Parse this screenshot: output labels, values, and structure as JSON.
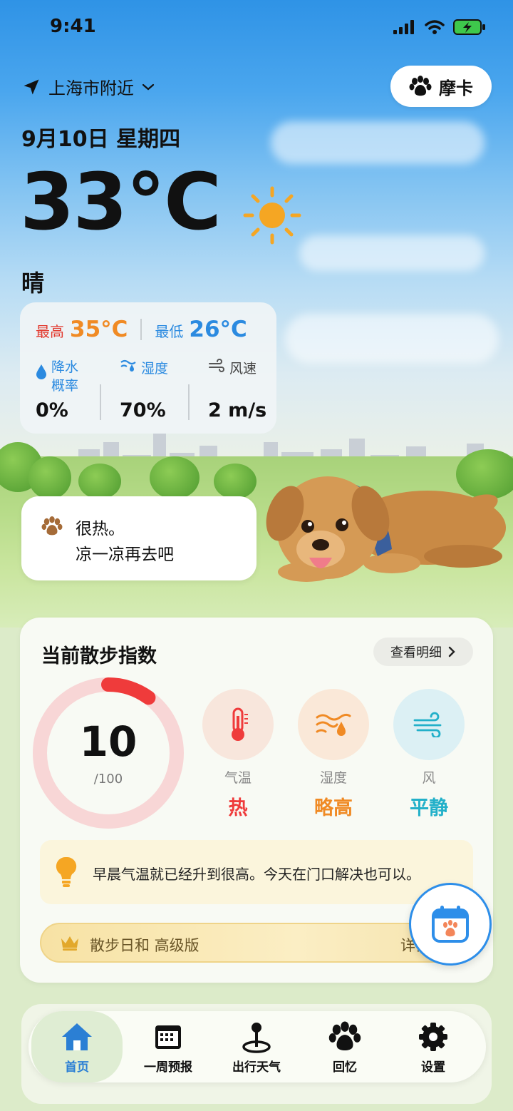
{
  "status_bar": {
    "time": "9:41"
  },
  "header": {
    "location": "上海市附近",
    "pet_name": "摩卡",
    "date": "9月10日 星期四",
    "temperature": "33°C",
    "condition": "晴"
  },
  "stats": {
    "high_label": "最高",
    "high_value": "35°C",
    "low_label": "最低",
    "low_value": "26°C",
    "precip_label_1": "降水",
    "precip_label_2": "概率",
    "precip_value": "0%",
    "humidity_label": "湿度",
    "humidity_value": "70%",
    "wind_label": "风速",
    "wind_value": "2 m/s"
  },
  "message": {
    "line1": "很热。",
    "line2": "凉一凉再去吧"
  },
  "walk_index": {
    "title": "当前散步指数",
    "detail_button": "查看明细",
    "score": "10",
    "score_max": "/100",
    "score_fraction": 0.1,
    "factors": [
      {
        "name": "气温",
        "level": "热",
        "color": "#ef3b3b",
        "icon": "thermometer-icon"
      },
      {
        "name": "湿度",
        "level": "略高",
        "color": "#f08a24",
        "icon": "humidity-icon"
      },
      {
        "name": "风",
        "level": "平静",
        "color": "#22b0c9",
        "icon": "wind-icon"
      }
    ],
    "tip": "早晨气温就已经升到很高。今天在门口解决也可以。",
    "premium_label": "散步日和 高级版",
    "premium_detail": "详情"
  },
  "tabs": [
    {
      "label": "首页",
      "icon": "home-icon",
      "active": true
    },
    {
      "label": "一周预报",
      "icon": "calendar-icon",
      "active": false
    },
    {
      "label": "出行天气",
      "icon": "location-pin-icon",
      "active": false
    },
    {
      "label": "回忆",
      "icon": "paw-icon",
      "active": false
    },
    {
      "label": "设置",
      "icon": "gear-icon",
      "active": false
    }
  ],
  "colors": {
    "high": "#f08a24",
    "low": "#2b8ae0",
    "accent_blue": "#2d8ee9",
    "ring_track": "#f8d6d6",
    "ring_fill": "#ef3b3b"
  }
}
